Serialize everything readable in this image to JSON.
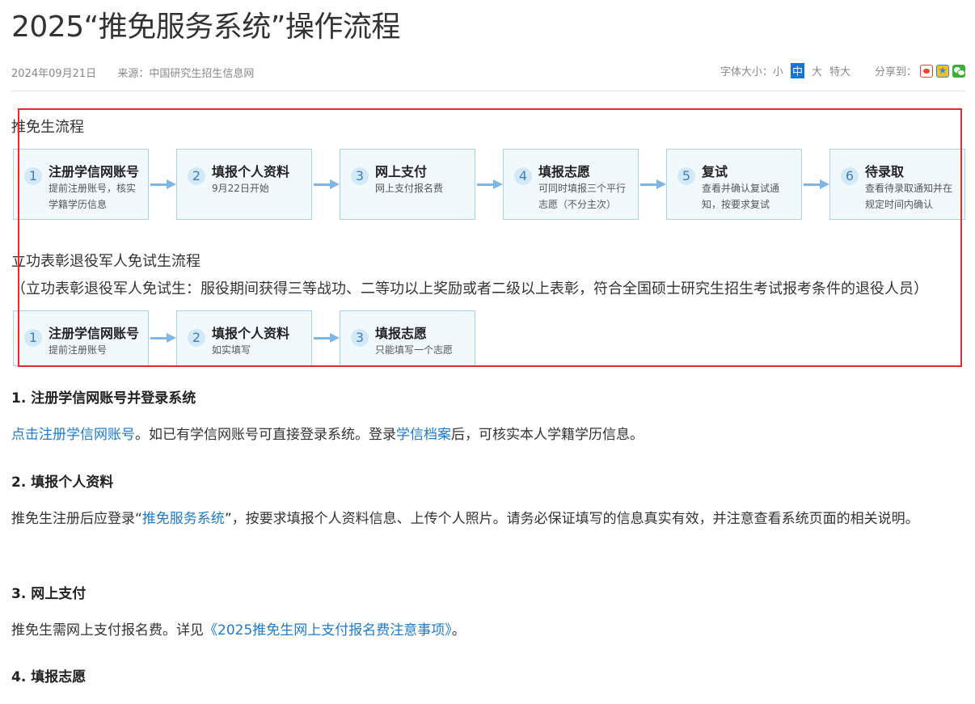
{
  "page_title": "2025“推免服务系统”操作流程",
  "meta": {
    "date": "2024年09月21日",
    "source": "来源：中国研究生招生信息网",
    "font_size_label": "字体大小：",
    "font_sizes": [
      "小",
      "中",
      "大",
      "特大"
    ],
    "font_size_selected": "中",
    "share_label": "分享到："
  },
  "share_icons": [
    "weibo-icon",
    "qzone-icon",
    "wechat-icon"
  ],
  "flow1": {
    "title": "推免生流程",
    "steps": [
      {
        "num": "1",
        "name": "注册学信网账号",
        "desc": "提前注册账号，核实学籍学历信息"
      },
      {
        "num": "2",
        "name": "填报个人资料",
        "desc": "9月22日开始"
      },
      {
        "num": "3",
        "name": "网上支付",
        "desc": "网上支付报名费"
      },
      {
        "num": "4",
        "name": "填报志愿",
        "desc": "可同时填报三个平行志愿（不分主次）"
      },
      {
        "num": "5",
        "name": "复试",
        "desc": "查看并确认复试通知，按要求复试"
      },
      {
        "num": "6",
        "name": "待录取",
        "desc": "查看待录取通知并在规定时间内确认"
      }
    ]
  },
  "flow2": {
    "title": "立功表彰退役军人免试生流程",
    "note": "（立功表彰退役军人免试生：服役期间获得三等战功、二等功以上奖励或者二级以上表彰，符合全国硕士研究生招生考试报考条件的退役人员）",
    "steps": [
      {
        "num": "1",
        "name": "注册学信网账号",
        "desc": "提前注册账号"
      },
      {
        "num": "2",
        "name": "填报个人资料",
        "desc": "如实填写"
      },
      {
        "num": "3",
        "name": "填报志愿",
        "desc": "只能填写一个志愿"
      }
    ]
  },
  "sections": [
    {
      "heading": "1. 注册学信网账号并登录系统",
      "link1": "点击注册学信网账号",
      "text1": "。如已有学信网账号可直接登录系统。登录",
      "link2": "学信档案",
      "text2": "后，可核实本人学籍学历信息。"
    },
    {
      "heading": "2. 填报个人资料",
      "text1": "推免生注册后应登录“",
      "link1": "推免服务系统",
      "text2": "”，按要求填报个人资料信息、上传个人照片。请务必保证填写的信息真实有效，并注意查看系统页面的相关说明。"
    },
    {
      "heading": "3. 网上支付",
      "text1": "推免生需网上支付报名费。详见",
      "link1": "《2025推免生网上支付报名费注意事项》",
      "text2": "。"
    },
    {
      "heading": "4. 填报志愿"
    }
  ]
}
